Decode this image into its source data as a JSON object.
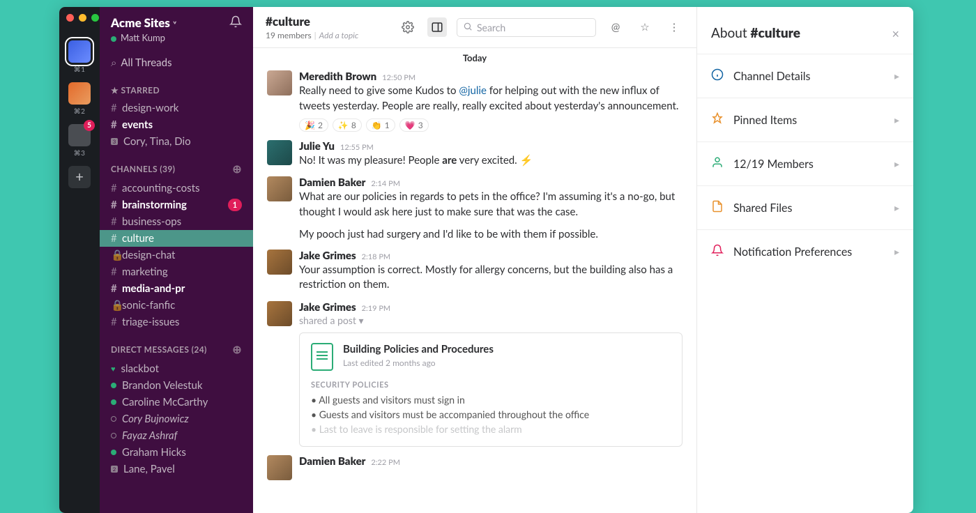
{
  "workspace_rail": {
    "items": [
      {
        "key": "⌘1",
        "badge": null
      },
      {
        "key": "⌘2",
        "badge": null
      },
      {
        "key": "⌘3",
        "badge": "5"
      }
    ]
  },
  "sidebar": {
    "workspace_name": "Acme Sites",
    "current_user": "Matt Kump",
    "all_threads": "All Threads",
    "starred": {
      "title": "STARRED",
      "items": [
        {
          "prefix": "#",
          "label": "design-work",
          "unread": false
        },
        {
          "prefix": "#",
          "label": "events",
          "unread": true
        },
        {
          "prefix": "sq",
          "label": "Cory, Tina, Dio",
          "unread": false,
          "sqnum": "3"
        }
      ]
    },
    "channels": {
      "title": "CHANNELS",
      "count": "(39)",
      "items": [
        {
          "prefix": "#",
          "label": "accounting-costs"
        },
        {
          "prefix": "#",
          "label": "brainstorming",
          "unread": true,
          "badge": "1"
        },
        {
          "prefix": "#",
          "label": "business-ops"
        },
        {
          "prefix": "#",
          "label": "culture",
          "active": true
        },
        {
          "prefix": "lock",
          "label": "design-chat"
        },
        {
          "prefix": "#",
          "label": "marketing"
        },
        {
          "prefix": "#",
          "label": "media-and-pr",
          "unread": true
        },
        {
          "prefix": "lock",
          "label": "sonic-fanfic"
        },
        {
          "prefix": "#",
          "label": "triage-issues"
        }
      ]
    },
    "dms": {
      "title": "DIRECT MESSAGES",
      "count": "(24)",
      "items": [
        {
          "status": "heart",
          "label": "slackbot"
        },
        {
          "status": "online",
          "label": "Brandon Velestuk"
        },
        {
          "status": "online",
          "label": "Caroline McCarthy"
        },
        {
          "status": "away",
          "label": "Cory Bujnowicz",
          "italic": true
        },
        {
          "status": "away",
          "label": "Fayaz Ashraf",
          "italic": true
        },
        {
          "status": "online",
          "label": "Graham Hicks"
        },
        {
          "status": "sq",
          "label": "Lane, Pavel",
          "sqnum": "2"
        }
      ]
    }
  },
  "header": {
    "channel_name": "#culture",
    "members": "19 members",
    "topic_placeholder": "Add a topic",
    "search_placeholder": "Search"
  },
  "divider": "Today",
  "messages": [
    {
      "avatar": "av-meredith",
      "author": "Meredith Brown",
      "time": "12:50 PM",
      "text_before": "Really need to give some Kudos to ",
      "mention": "@julie",
      "text_after": " for helping out with the new influx of tweets yesterday. People are really, really excited about yesterday's announcement.",
      "reactions": [
        {
          "e": "🎉",
          "c": "2"
        },
        {
          "e": "✨",
          "c": "8"
        },
        {
          "e": "👏",
          "c": "1"
        },
        {
          "e": "💗",
          "c": "3"
        }
      ]
    },
    {
      "avatar": "av-julie",
      "author": "Julie Yu",
      "time": "12:55 PM",
      "text_before": "No! It was my pleasure! People ",
      "bold": "are",
      "text_after": " very excited. ⚡"
    },
    {
      "avatar": "av-damien",
      "author": "Damien Baker",
      "time": "2:14 PM",
      "text": "What are our policies in regards to pets in the office? I'm assuming it's a no-go, but thought I would ask here just to make sure that was the case.",
      "continuation": "My pooch just had surgery and I'd like to be with them if possible."
    },
    {
      "avatar": "av-jake",
      "author": "Jake Grimes",
      "time": "2:18 PM",
      "text": "Your assumption is correct. Mostly for allergy concerns, but the building also has a restriction on them."
    },
    {
      "avatar": "av-jake",
      "author": "Jake Grimes",
      "time": "2:19 PM",
      "shared": "shared a post",
      "attachment": {
        "title": "Building Policies and Procedures",
        "subtitle": "Last edited 2 months ago",
        "section": "SECURITY POLICIES",
        "bullets": [
          "All guests and visitors must sign in",
          "Guests and visitors must be accompanied throughout the office",
          "Last to leave is responsible for setting the alarm"
        ]
      }
    },
    {
      "avatar": "av-damien",
      "author": "Damien Baker",
      "time": "2:22 PM"
    }
  ],
  "details": {
    "title_prefix": "About ",
    "title_channel": "#culture",
    "rows": [
      {
        "icon": "info",
        "color": "#1264a3",
        "label": "Channel Details"
      },
      {
        "icon": "pin",
        "color": "#e8912d",
        "label": "Pinned Items"
      },
      {
        "icon": "user",
        "color": "#2bac76",
        "label": "12/19 Members"
      },
      {
        "icon": "file",
        "color": "#e8912d",
        "label": "Shared Files"
      },
      {
        "icon": "bell",
        "color": "#e01e5a",
        "label": "Notification Preferences"
      }
    ]
  }
}
